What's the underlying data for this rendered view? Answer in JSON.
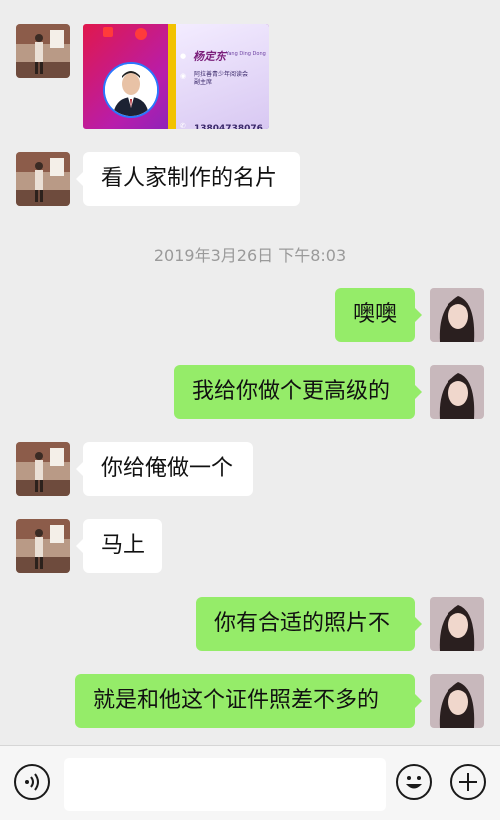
{
  "messages": [
    {
      "side": "in",
      "type": "image"
    },
    {
      "side": "in",
      "text": "看人家制作的名片"
    },
    {
      "side": "out",
      "text": "噢噢"
    },
    {
      "side": "out",
      "text": "我给你做个更高级的"
    },
    {
      "side": "in",
      "text": "你给俺做一个"
    },
    {
      "side": "in",
      "text": "马上"
    },
    {
      "side": "out",
      "text": "你有合适的照片不"
    },
    {
      "side": "out",
      "text": "就是和他这个证件照差不多的"
    }
  ],
  "timestamp": "2019年3月26日 下午8:03",
  "card": {
    "name": "杨定东",
    "pinyin": "Yang Ding Dong",
    "org_line1": "阿拉善青少年阅读会",
    "org_line2": "副主席",
    "phone": "13804738076"
  },
  "input": {
    "placeholder": "",
    "voice_icon": "voice-icon",
    "emoji_icon": "emoji-icon",
    "plus_icon": "plus-icon"
  },
  "colors": {
    "background": "#ededed",
    "outgoing_bubble": "#95ec69",
    "incoming_bubble": "#ffffff"
  }
}
